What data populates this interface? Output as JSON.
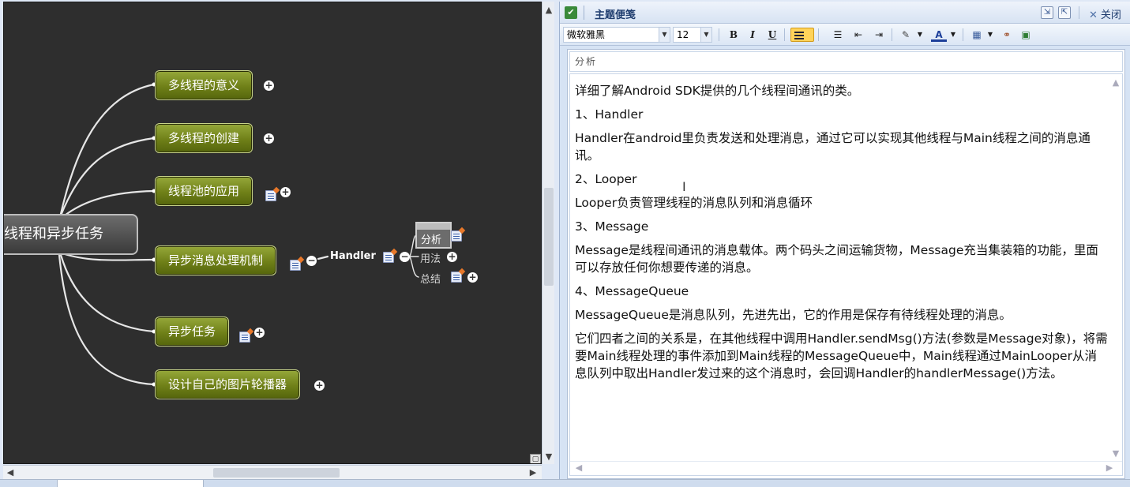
{
  "mindmap": {
    "root": "多线程和异步任务",
    "branches": [
      {
        "label": "多线程的意义"
      },
      {
        "label": "多线程的创建"
      },
      {
        "label": "线程池的应用"
      },
      {
        "label": "异步消息处理机制"
      },
      {
        "label": "异步任务"
      },
      {
        "label": "设计自己的图片轮播器"
      }
    ],
    "handler": "Handler",
    "subtopics": [
      "分析",
      "用法",
      "总结"
    ]
  },
  "notes": {
    "title": "主题便笺",
    "close_label": "关闭",
    "font_name": "微软雅黑",
    "font_size": "12",
    "bold_label": "B",
    "italic_label": "I",
    "underline_label": "U",
    "subject": "分析",
    "paragraphs": [
      "详细了解Android SDK提供的几个线程间通讯的类。",
      "1、Handler",
      "Handler在android里负责发送和处理消息，通过它可以实现其他线程与Main线程之间的消息通讯。",
      "2、Looper",
      "Looper负责管理线程的消息队列和消息循环",
      "3、Message",
      "Message是线程间通讯的消息载体。两个码头之间运输货物，Message充当集装箱的功能，里面可以存放任何你想要传递的消息。",
      "4、MessageQueue",
      "MessageQueue是消息队列，先进先出，它的作用是保存有待线程处理的消息。",
      "它们四者之间的关系是，在其他线程中调用Handler.sendMsg()方法(参数是Message对象)，将需要Main线程处理的事件添加到Main线程的MessageQueue中，Main线程通过MainLooper从消息队列中取出Handler发过来的这个消息时，会回调Handler的handlerMessage()方法。"
    ]
  },
  "colors": {
    "canvas_bg": "#2e2e2e",
    "branch_green": "#6f8018",
    "connector": "#e0e0e0",
    "panel_bg": "#d6e3f4",
    "highlight": "#ffd35a"
  }
}
